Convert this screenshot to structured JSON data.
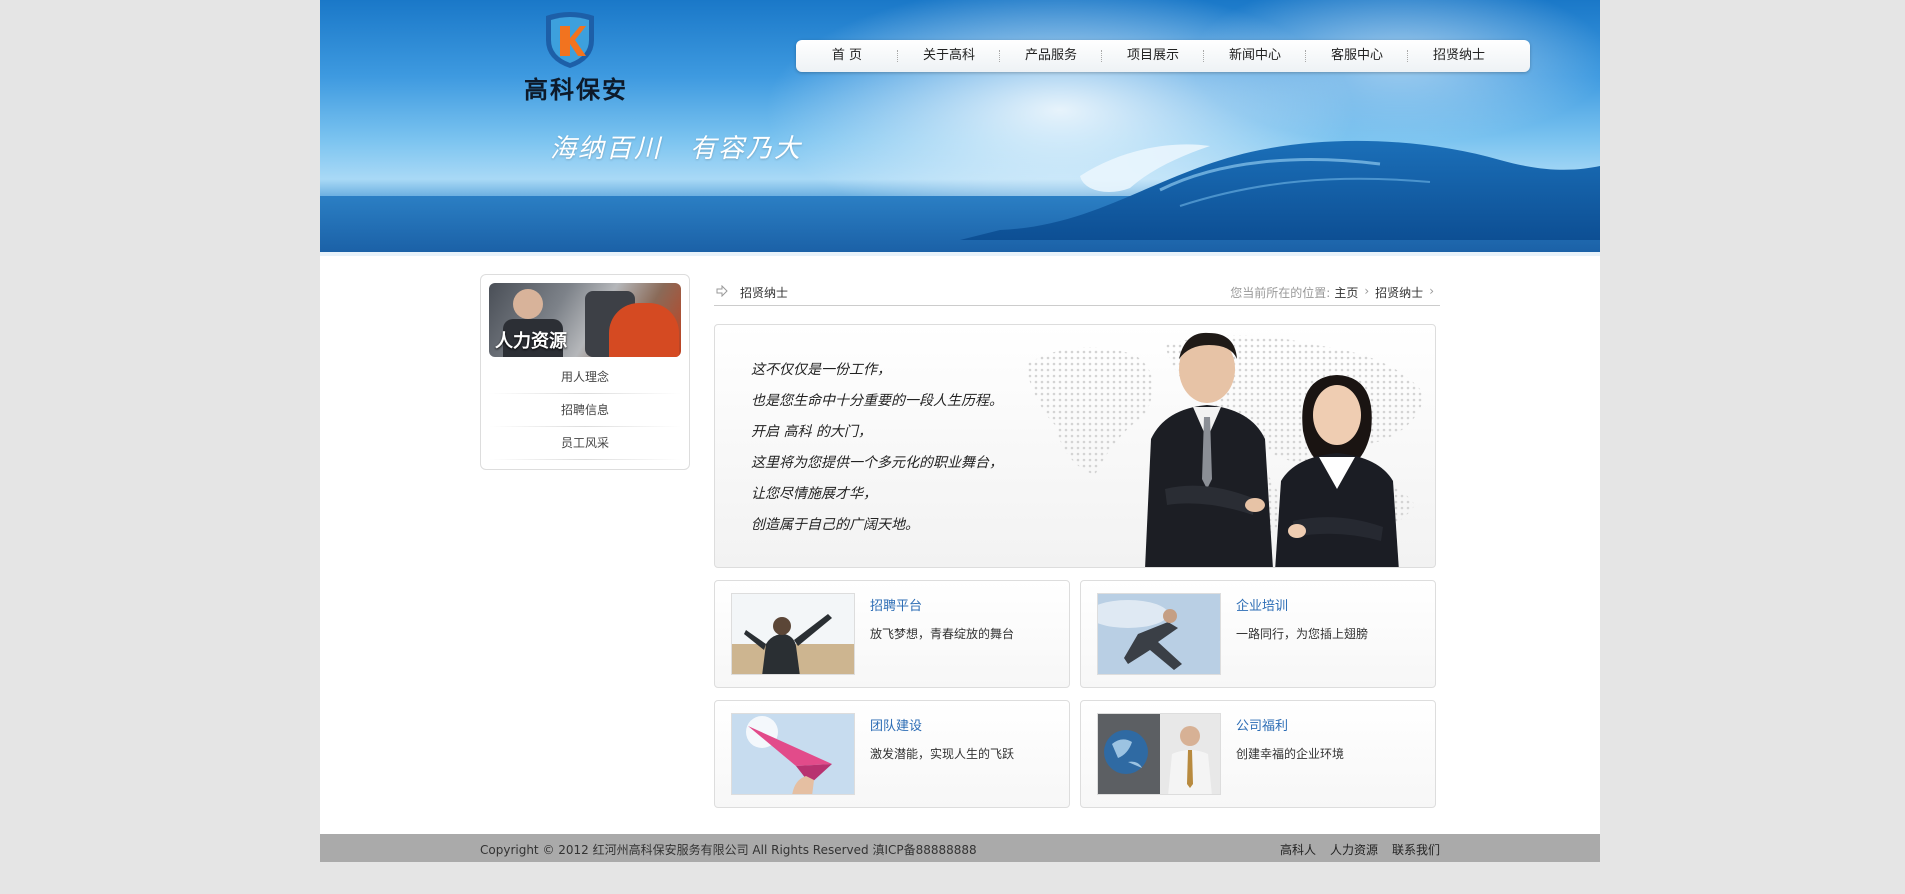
{
  "brand": {
    "name": "高科保安",
    "slogan": "海纳百川　有容乃大",
    "primary_color": "#2d6db5"
  },
  "nav": [
    {
      "label": "首 页"
    },
    {
      "label": "关于高科"
    },
    {
      "label": "产品服务"
    },
    {
      "label": "项目展示"
    },
    {
      "label": "新闻中心"
    },
    {
      "label": "客服中心"
    },
    {
      "label": "招贤纳士"
    }
  ],
  "sidebar": {
    "title": "人力资源",
    "items": [
      {
        "label": "用人理念"
      },
      {
        "label": "招聘信息"
      },
      {
        "label": "员工风采"
      }
    ]
  },
  "breadcrumb": {
    "section": "招贤纳士",
    "location_label": "您当前所在的位置:",
    "path": [
      "主页",
      "招贤纳士"
    ]
  },
  "hero": {
    "lines": [
      "这不仅仅是一份工作，",
      "也是您生命中十分重要的一段人生历程。",
      "开启 高科 的大门，",
      "这里将为您提供一个多元化的职业舞台，",
      "让您尽情施展才华，",
      "创造属于自己的广阔天地。"
    ]
  },
  "cards": [
    {
      "title": "招聘平台",
      "desc": "放飞梦想，青春绽放的舞台",
      "icon": "man-waving-photo"
    },
    {
      "title": "企业培训",
      "desc": "一路同行，为您插上翅膀",
      "icon": "man-leaping-photo"
    },
    {
      "title": "团队建设",
      "desc": "激发潜能，实现人生的飞跃",
      "icon": "paper-plane-photo"
    },
    {
      "title": "公司福利",
      "desc": "创建幸福的企业环境",
      "icon": "man-with-globe-photo"
    }
  ],
  "footer": {
    "copyright": "Copyright © 2012 红河州高科保安服务有限公司 All Rights Reserved 滇ICP备88888888",
    "links": [
      "高科人",
      "人力资源",
      "联系我们"
    ]
  }
}
